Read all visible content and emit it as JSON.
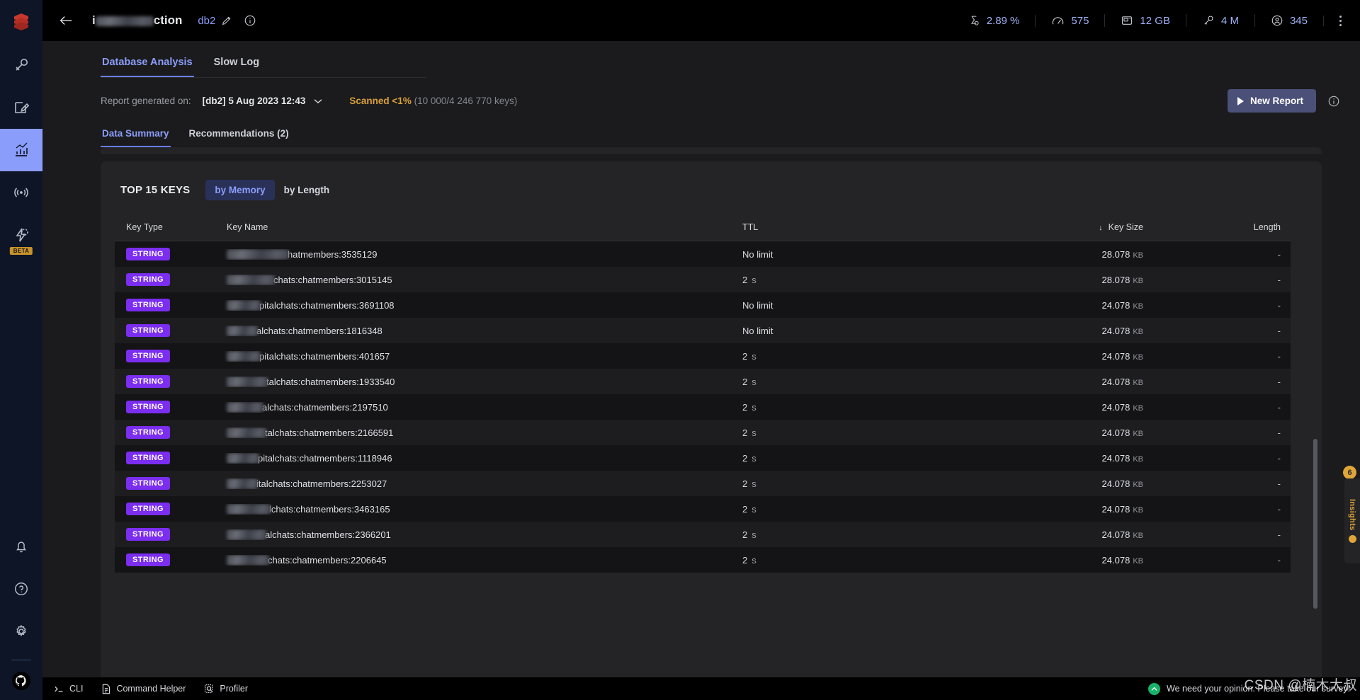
{
  "sidebar": {
    "logo_name": "redis-logo",
    "items": [
      {
        "name": "browser",
        "icon": "key-icon",
        "active": false
      },
      {
        "name": "workbench",
        "icon": "edit-note-icon",
        "active": false
      },
      {
        "name": "analysis-tools",
        "icon": "bar-chart-icon",
        "active": true
      },
      {
        "name": "pubsub",
        "icon": "broadcast-icon",
        "active": false
      },
      {
        "name": "triggers-functions",
        "icon": "lightning-gear-icon",
        "active": false,
        "badge": "BETA"
      }
    ],
    "bottom_items": [
      {
        "name": "notifications",
        "icon": "bell-icon"
      },
      {
        "name": "help",
        "icon": "question-circle-icon"
      },
      {
        "name": "settings",
        "icon": "gear-icon"
      },
      {
        "name": "github",
        "icon": "github-icon"
      }
    ]
  },
  "header": {
    "back_label": "back-arrow",
    "instance_title_prefix": "i",
    "instance_title_suffix": "ction",
    "database_label": "db2",
    "edit_icon": "pencil-icon",
    "info_icon": "info-circle-icon",
    "metrics": [
      {
        "icon": "hourglass-icon",
        "value": "2.89 %",
        "name": "cpu-metric"
      },
      {
        "icon": "speedometer-icon",
        "value": "575",
        "name": "ops-per-second-metric"
      },
      {
        "icon": "memory-card-icon",
        "value": "12 GB",
        "name": "memory-metric"
      },
      {
        "icon": "key-icon",
        "value": "4 M",
        "name": "keys-metric"
      },
      {
        "icon": "user-circle-icon",
        "value": "345",
        "name": "clients-metric"
      }
    ],
    "overflow_icon": "kebab-menu-icon"
  },
  "main_tabs": [
    {
      "label": "Database Analysis",
      "active": true
    },
    {
      "label": "Slow Log",
      "active": false
    }
  ],
  "report_bar": {
    "label": "Report generated on:",
    "selected_report": "[db2] 5 Aug 2023 12:43",
    "chevron_icon": "chevron-down-icon",
    "scanned_label": "Scanned <1%",
    "scanned_detail": "(10 000/4 246 770 keys)",
    "new_report_label": "New Report",
    "new_report_icon": "play-icon",
    "info_icon": "info-circle-icon"
  },
  "sub_tabs": [
    {
      "label": "Data Summary",
      "active": true
    },
    {
      "label": "Recommendations (2)",
      "active": false
    }
  ],
  "panel": {
    "title": "TOP 15 KEYS",
    "segments": [
      {
        "label": "by Memory",
        "active": true
      },
      {
        "label": "by Length",
        "active": false
      }
    ],
    "columns": {
      "key_type": "Key Type",
      "key_name": "Key Name",
      "ttl": "TTL",
      "key_size": "Key Size",
      "length": "Length",
      "sort_icon": "sort-descending-arrow"
    },
    "rows": [
      {
        "type": "STRING",
        "blur_width": 88,
        "key_name": "hatmembers:3535129",
        "ttl": "No limit",
        "ttl_unit": "",
        "size": "28.078",
        "size_unit": "KB",
        "length": "-"
      },
      {
        "type": "STRING",
        "blur_width": 68,
        "key_name": "chats:chatmembers:3015145",
        "ttl": "2",
        "ttl_unit": "s",
        "size": "28.078",
        "size_unit": "KB",
        "length": "-"
      },
      {
        "type": "STRING",
        "blur_width": 48,
        "key_name": "pitalchats:chatmembers:3691108",
        "ttl": "No limit",
        "ttl_unit": "",
        "size": "24.078",
        "size_unit": "KB",
        "length": "-"
      },
      {
        "type": "STRING",
        "blur_width": 44,
        "key_name": "alchats:chatmembers:1816348",
        "ttl": "No limit",
        "ttl_unit": "",
        "size": "24.078",
        "size_unit": "KB",
        "length": "-"
      },
      {
        "type": "STRING",
        "blur_width": 48,
        "key_name": "pitalchats:chatmembers:401657",
        "ttl": "2",
        "ttl_unit": "s",
        "size": "24.078",
        "size_unit": "KB",
        "length": "-"
      },
      {
        "type": "STRING",
        "blur_width": 58,
        "key_name": "talchats:chatmembers:1933540",
        "ttl": "2",
        "ttl_unit": "s",
        "size": "24.078",
        "size_unit": "KB",
        "length": "-"
      },
      {
        "type": "STRING",
        "blur_width": 52,
        "key_name": "alchats:chatmembers:2197510",
        "ttl": "2",
        "ttl_unit": "s",
        "size": "24.078",
        "size_unit": "KB",
        "length": "-"
      },
      {
        "type": "STRING",
        "blur_width": 56,
        "key_name": "talchats:chatmembers:2166591",
        "ttl": "2",
        "ttl_unit": "s",
        "size": "24.078",
        "size_unit": "KB",
        "length": "-"
      },
      {
        "type": "STRING",
        "blur_width": 46,
        "key_name": "pitalchats:chatmembers:1118946",
        "ttl": "2",
        "ttl_unit": "s",
        "size": "24.078",
        "size_unit": "KB",
        "length": "-"
      },
      {
        "type": "STRING",
        "blur_width": 44,
        "key_name": "italchats:chatmembers:2253027",
        "ttl": "2",
        "ttl_unit": "s",
        "size": "24.078",
        "size_unit": "KB",
        "length": "-"
      },
      {
        "type": "STRING",
        "blur_width": 62,
        "key_name": "lchats:chatmembers:3463165",
        "ttl": "2",
        "ttl_unit": "s",
        "size": "24.078",
        "size_unit": "KB",
        "length": "-"
      },
      {
        "type": "STRING",
        "blur_width": 56,
        "key_name": "alchats:chatmembers:2366201",
        "ttl": "2",
        "ttl_unit": "s",
        "size": "24.078",
        "size_unit": "KB",
        "length": "-"
      },
      {
        "type": "STRING",
        "blur_width": 60,
        "key_name": "chats:chatmembers:2206645",
        "ttl": "2",
        "ttl_unit": "s",
        "size": "24.078",
        "size_unit": "KB",
        "length": "-"
      }
    ]
  },
  "insights": {
    "label": "Insights",
    "badge_count": "6"
  },
  "bottom_bar": {
    "cli_label": "CLI",
    "cli_icon": "terminal-prompt-icon",
    "command_helper_label": "Command Helper",
    "command_helper_icon": "document-icon",
    "profiler_label": "Profiler",
    "profiler_icon": "magnifier-document-icon",
    "survey_text": "We need your opinion. Please take our survey!",
    "survey_icon": "feedback-icon"
  },
  "watermark": "CSDN @楠木大叔",
  "colors": {
    "accent_blue": "#8b9dfa",
    "badge_purple": "#7b2df0",
    "warning_orange": "#d8a13a",
    "insights_orange": "#e0a53a",
    "panel_bg": "#242426",
    "page_bg": "#1b1b1d",
    "rail_bg": "#0d1526"
  }
}
